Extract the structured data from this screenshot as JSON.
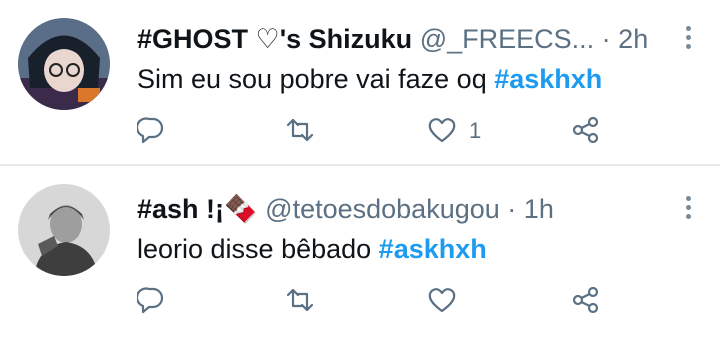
{
  "tweets": [
    {
      "display_name": "#GHOST ♡'s Shizuku",
      "handle": "@_FREECS...",
      "separator": "·",
      "time": "2h",
      "text": "Sim eu sou pobre vai faze oq ",
      "hashtag": "#askhxh",
      "like_count": "1"
    },
    {
      "display_name": "#ash !¡🍫",
      "handle": "@tetoesdobakugou",
      "separator": "·",
      "time": "1h",
      "text": "leorio disse bêbado ",
      "hashtag": "#askhxh",
      "like_count": ""
    }
  ],
  "icons": {
    "reply": "reply-icon",
    "retweet": "retweet-icon",
    "like": "heart-icon",
    "share": "share-icon",
    "more": "more-options-icon"
  },
  "colors": {
    "hashtag": "#1d9bf0",
    "secondary_text": "#5b7083",
    "icon": "#5b7083",
    "divider": "#e6e9eb"
  }
}
